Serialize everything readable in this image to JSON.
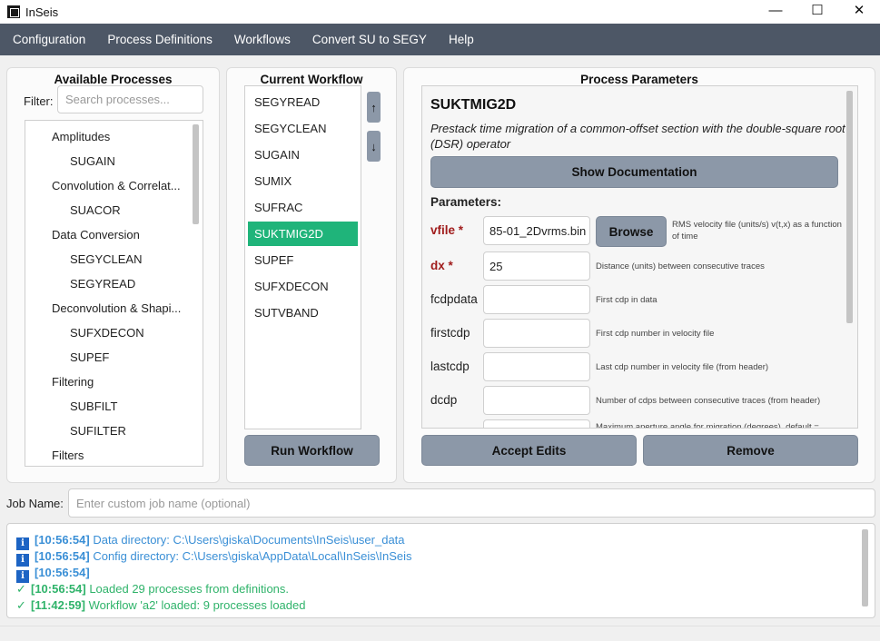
{
  "window": {
    "title": "InSeis",
    "minimize": "—",
    "maximize": "☐",
    "close": "✕"
  },
  "menu": [
    "Configuration",
    "Process Definitions",
    "Workflows",
    "Convert SU to SEGY",
    "Help"
  ],
  "available": {
    "title": "Available Processes",
    "filter_label": "Filter:",
    "filter_placeholder": "Search processes...",
    "tree": [
      {
        "label": "Amplitudes",
        "level": 0
      },
      {
        "label": "SUGAIN",
        "level": 1
      },
      {
        "label": "Convolution & Correlat...",
        "level": 0
      },
      {
        "label": "SUACOR",
        "level": 1
      },
      {
        "label": "Data Conversion",
        "level": 0
      },
      {
        "label": "SEGYCLEAN",
        "level": 1
      },
      {
        "label": "SEGYREAD",
        "level": 1
      },
      {
        "label": "Deconvolution & Shapi...",
        "level": 0
      },
      {
        "label": "SUFXDECON",
        "level": 1
      },
      {
        "label": "SUPEF",
        "level": 1
      },
      {
        "label": "Filtering",
        "level": 0
      },
      {
        "label": "SUBFILT",
        "level": 1
      },
      {
        "label": "SUFILTER",
        "level": 1
      },
      {
        "label": "Filters",
        "level": 0
      }
    ]
  },
  "workflow": {
    "title": "Current Workflow",
    "items": [
      "SEGYREAD",
      "SEGYCLEAN",
      "SUGAIN",
      "SUMIX",
      "SUFRAC",
      "SUKTMIG2D",
      "SUPEF",
      "SUFXDECON",
      "SUTVBAND"
    ],
    "selected_index": 5,
    "up_label": "↑",
    "down_label": "↓",
    "run_label": "Run Workflow"
  },
  "params": {
    "title": "Process Parameters",
    "process_name": "SUKTMIG2D",
    "description": "Prestack time migration of a common-offset section with the double-square root (DSR) operator",
    "show_doc_label": "Show Documentation",
    "parameters_label": "Parameters:",
    "browse_label": "Browse",
    "rows": [
      {
        "name": "vfile *",
        "required": true,
        "value": "85-01_2Dvrms.bin",
        "desc": "RMS velocity file (units/s) v(t,x) as a function of time",
        "browse": true
      },
      {
        "name": "dx *",
        "required": true,
        "value": "25",
        "desc": "Distance (units) between consecutive traces",
        "browse": false
      },
      {
        "name": "fcdpdata",
        "required": false,
        "value": "",
        "desc": "First cdp in data",
        "browse": false
      },
      {
        "name": "firstcdp",
        "required": false,
        "value": "",
        "desc": "First cdp number in velocity file",
        "browse": false
      },
      {
        "name": "lastcdp",
        "required": false,
        "value": "",
        "desc": "Last cdp number in velocity file (from header)",
        "browse": false
      },
      {
        "name": "dcdp",
        "required": false,
        "value": "",
        "desc": "Number of cdps between consecutive traces (from header)",
        "browse": false
      },
      {
        "name": "",
        "required": false,
        "value": "",
        "desc": "Maximum aperture angle for migration (degrees), default =",
        "browse": false
      }
    ],
    "accept_label": "Accept Edits",
    "remove_label": "Remove"
  },
  "job": {
    "label": "Job Name:",
    "placeholder": "Enter custom job name (optional)"
  },
  "log": [
    {
      "type": "info",
      "time": "[10:56:54]",
      "text": "Data directory: C:\\Users\\giska\\Documents\\InSeis\\user_data"
    },
    {
      "type": "info",
      "time": "[10:56:54]",
      "text": "Config directory: C:\\Users\\giska\\AppData\\Local\\InSeis\\InSeis"
    },
    {
      "type": "info",
      "time": "[10:56:54]",
      "text": ""
    },
    {
      "type": "success",
      "time": "[10:56:54]",
      "text": "Loaded 29 processes from definitions."
    },
    {
      "type": "success",
      "time": "[11:42:59]",
      "text": "Workflow 'a2' loaded: 9 processes loaded"
    }
  ]
}
